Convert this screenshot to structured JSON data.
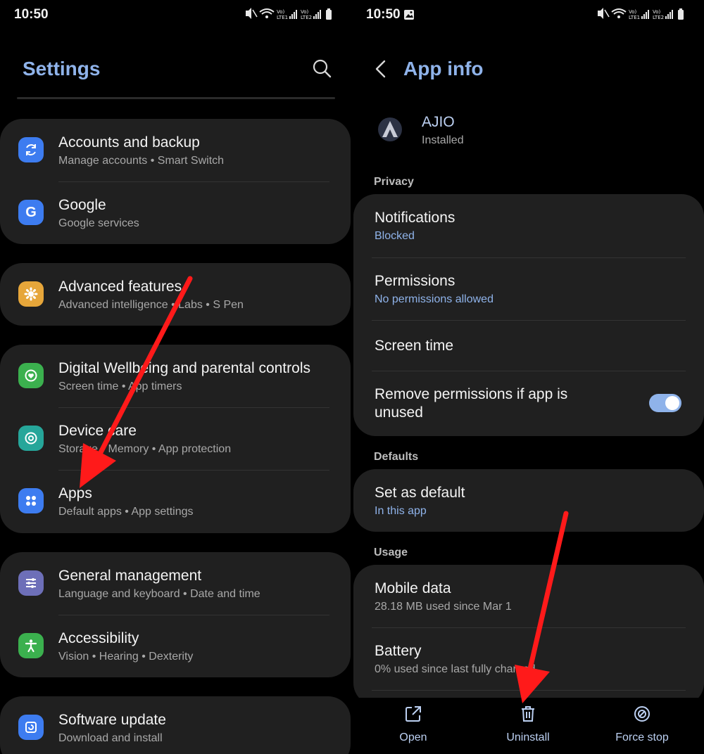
{
  "left": {
    "status_time": "10:50",
    "title": "Settings",
    "groups": [
      {
        "items": [
          {
            "label": "Accounts and backup",
            "sub": "Manage accounts  •  Smart Switch",
            "icon": "sync-icon",
            "color": "#3d7cf0"
          },
          {
            "label": "Google",
            "sub": "Google services",
            "icon": "google-icon",
            "color": "#3d7cf0"
          }
        ]
      },
      {
        "items": [
          {
            "label": "Advanced features",
            "sub": "Advanced intelligence  •  Labs  •  S Pen",
            "icon": "advanced-features-icon",
            "color": "#e6a63a"
          }
        ]
      },
      {
        "items": [
          {
            "label": "Digital Wellbeing and parental controls",
            "sub": "Screen time  •  App timers",
            "icon": "digital-wellbeing-icon",
            "color": "#3bb04e"
          },
          {
            "label": "Device care",
            "sub": "Storage  •  Memory  •  App protection",
            "icon": "device-care-icon",
            "color": "#26a69a"
          },
          {
            "label": "Apps",
            "sub": "Default apps  •  App settings",
            "icon": "apps-icon",
            "color": "#3d7cf0"
          }
        ]
      },
      {
        "items": [
          {
            "label": "General management",
            "sub": "Language and keyboard  •  Date and time",
            "icon": "general-management-icon",
            "color": "#6d6fb8"
          },
          {
            "label": "Accessibility",
            "sub": "Vision  •  Hearing  •  Dexterity",
            "icon": "accessibility-icon",
            "color": "#3bb04e"
          }
        ]
      },
      {
        "items": [
          {
            "label": "Software update",
            "sub": "Download and install",
            "icon": "software-update-icon",
            "color": "#3d7cf0"
          }
        ]
      }
    ]
  },
  "right": {
    "status_time": "10:50",
    "title": "App info",
    "app_name": "AJIO",
    "app_status": "Installed",
    "sections": {
      "privacy": "Privacy",
      "defaults": "Defaults",
      "usage": "Usage"
    },
    "privacy_items": [
      {
        "label": "Notifications",
        "sub": "Blocked"
      },
      {
        "label": "Permissions",
        "sub": "No permissions allowed"
      },
      {
        "label": "Screen time",
        "sub": ""
      },
      {
        "label": "Remove permissions if app is unused",
        "label_line1": "Remove permissions if app is",
        "label_line2": "unused",
        "toggle_on": true
      }
    ],
    "defaults_items": [
      {
        "label": "Set as default",
        "sub": "In this app"
      }
    ],
    "usage_items": [
      {
        "label": "Mobile data",
        "sub": "28.18 MB used since Mar 1"
      },
      {
        "label": "Battery",
        "sub": "0% used since last fully charged"
      }
    ],
    "bottom_actions": [
      {
        "label": "Open",
        "icon": "open-external-icon"
      },
      {
        "label": "Uninstall",
        "icon": "trash-icon"
      },
      {
        "label": "Force stop",
        "icon": "force-stop-icon"
      }
    ]
  },
  "colors": {
    "accent": "#8fb3ea",
    "card": "#202020",
    "arrow": "#ff1a1a"
  }
}
